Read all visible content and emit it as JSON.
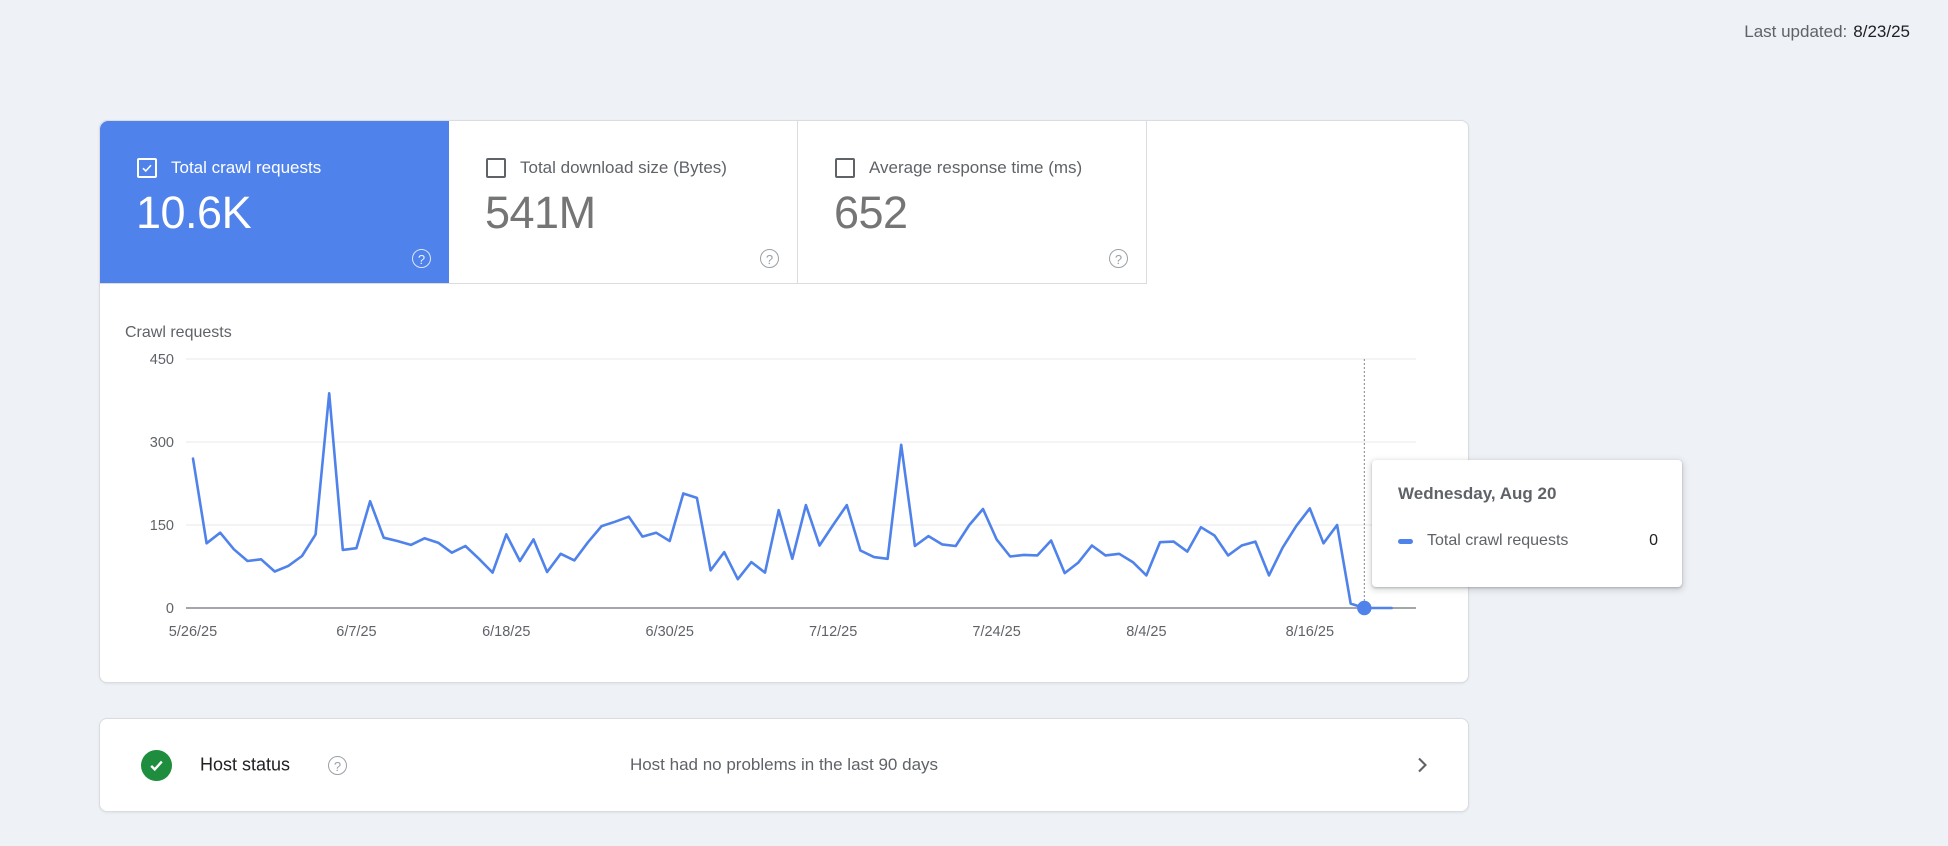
{
  "header": {
    "last_updated_label": "Last updated:",
    "last_updated_value": "8/23/25"
  },
  "icons": {
    "help": "?",
    "checked_checkbox": "check-mark",
    "host_ok": "check-mark",
    "chevron_right": ">"
  },
  "metric_cards": [
    {
      "label": "Total crawl requests",
      "value": "10.6K",
      "checked": true,
      "selected": true,
      "color": "#4f82ea"
    },
    {
      "label": "Total download size (Bytes)",
      "value": "541M",
      "checked": false,
      "selected": false
    },
    {
      "label": "Average response time (ms)",
      "value": "652",
      "checked": false,
      "selected": false
    }
  ],
  "chart_data": {
    "type": "line",
    "title": "Crawl requests",
    "x_start": "5/26/25",
    "x_interval_days": 1,
    "x_tick_labels": [
      "5/26/25",
      "6/7/25",
      "6/18/25",
      "6/30/25",
      "7/12/25",
      "7/24/25",
      "8/4/25",
      "8/16/25"
    ],
    "x_tick_day_index": [
      0,
      12,
      23,
      35,
      47,
      59,
      70,
      82
    ],
    "yticks": [
      0,
      150,
      300,
      450
    ],
    "ylim": [
      0,
      450
    ],
    "grid": true,
    "legend_position": "none",
    "series": [
      {
        "name": "Total crawl requests",
        "color": "#4f82ea",
        "values": [
          270,
          117,
          136,
          106,
          85,
          88,
          66,
          76,
          94,
          133,
          388,
          105,
          108,
          193,
          127,
          121,
          114,
          126,
          118,
          100,
          112,
          89,
          64,
          133,
          85,
          124,
          65,
          98,
          86,
          119,
          148,
          156,
          165,
          129,
          136,
          121,
          207,
          199,
          68,
          101,
          52,
          83,
          64,
          177,
          89,
          186,
          113,
          150,
          186,
          104,
          92,
          89,
          295,
          112,
          130,
          115,
          112,
          150,
          179,
          124,
          93,
          96,
          95,
          122,
          63,
          82,
          113,
          95,
          98,
          83,
          59,
          119,
          120,
          102,
          146,
          131,
          95,
          113,
          120,
          59,
          109,
          148,
          180,
          117,
          150,
          8,
          0,
          0,
          0
        ]
      }
    ],
    "hover": {
      "day_index": 86,
      "value": 0
    }
  },
  "tooltip": {
    "title": "Wednesday, Aug 20",
    "series_label": "Total crawl requests",
    "value": "0",
    "marker_color": "#4f82ea"
  },
  "host_status": {
    "title": "Host status",
    "message": "Host had no problems in the last 90 days",
    "status_color": "#1e8e3e"
  }
}
